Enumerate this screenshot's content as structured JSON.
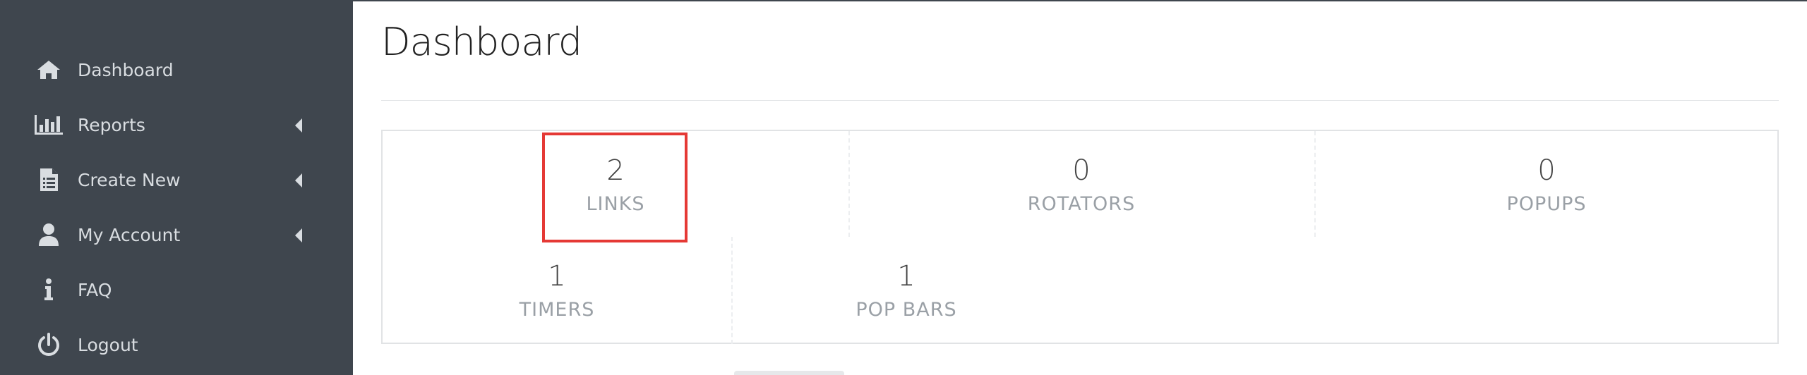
{
  "sidebar": {
    "items": [
      {
        "label": "Dashboard",
        "icon": "home-icon",
        "has_submenu": false
      },
      {
        "label": "Reports",
        "icon": "bar-chart-icon",
        "has_submenu": true
      },
      {
        "label": "Create New",
        "icon": "document-icon",
        "has_submenu": true
      },
      {
        "label": "My Account",
        "icon": "user-icon",
        "has_submenu": true
      },
      {
        "label": "FAQ",
        "icon": "info-icon",
        "has_submenu": false
      },
      {
        "label": "Logout",
        "icon": "power-icon",
        "has_submenu": false
      }
    ]
  },
  "main": {
    "title": "Dashboard",
    "stats": [
      {
        "value": "2",
        "label": "LINKS"
      },
      {
        "value": "0",
        "label": "ROTATORS"
      },
      {
        "value": "0",
        "label": "POPUPS"
      },
      {
        "value": "1",
        "label": "TIMERS"
      },
      {
        "value": "1",
        "label": "POP BARS"
      }
    ]
  },
  "colors": {
    "sidebar_bg": "#3f464e",
    "sidebar_text": "#d9dde1",
    "highlight": "#e53935"
  }
}
